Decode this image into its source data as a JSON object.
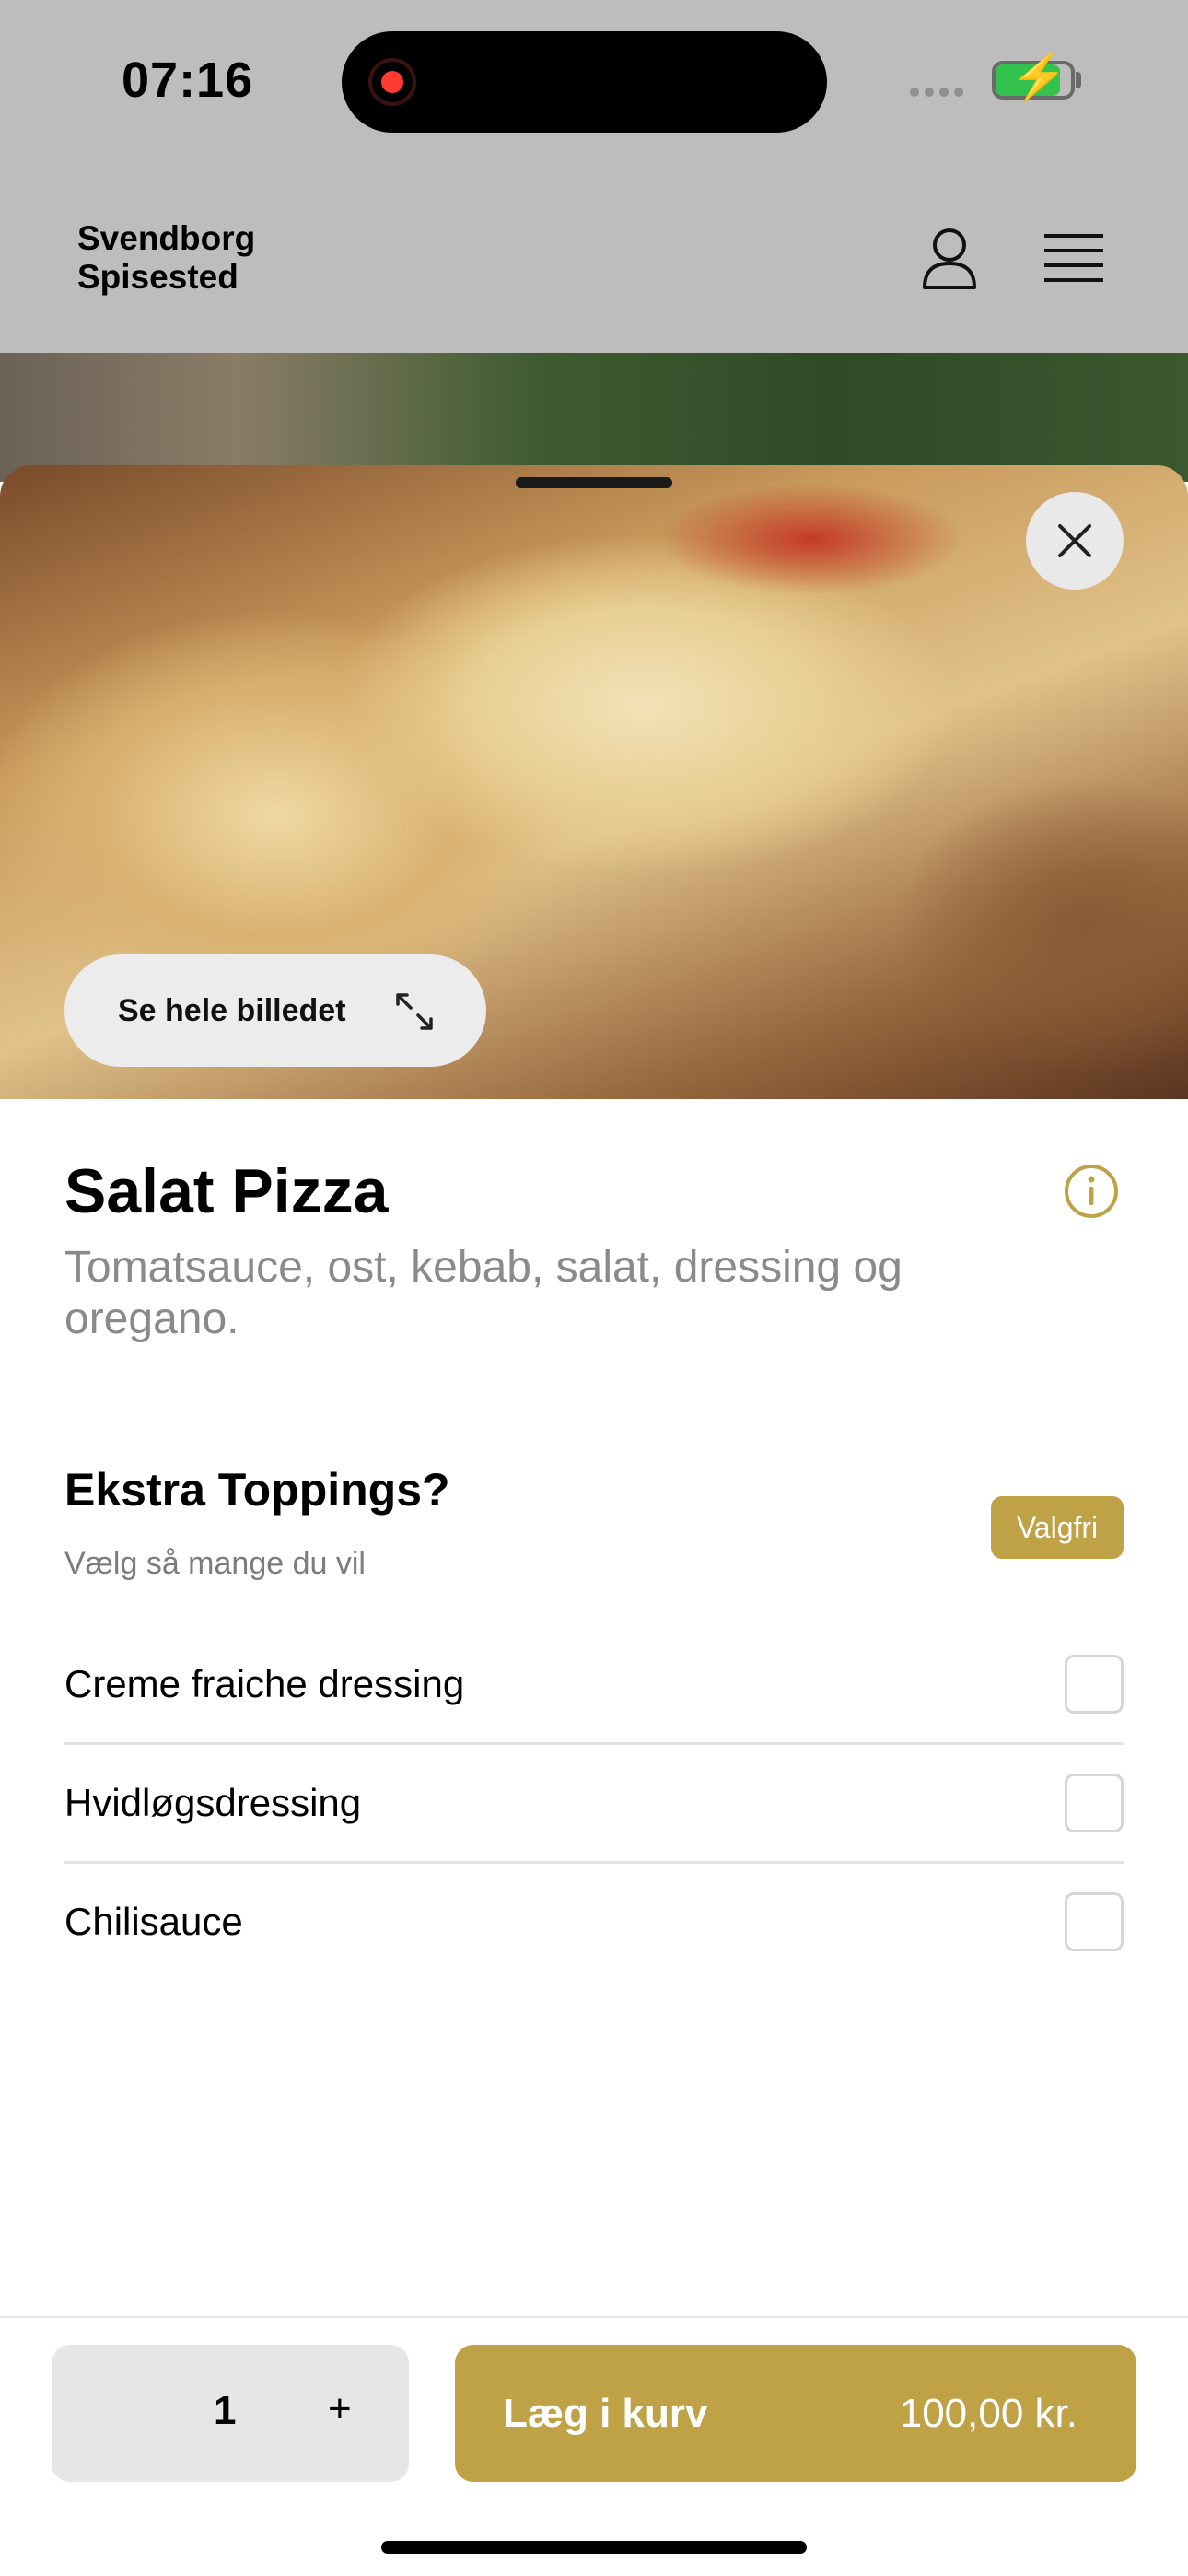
{
  "status_bar": {
    "time": "07:16"
  },
  "header": {
    "brand_line1": "Svendborg",
    "brand_line2": "Spisested"
  },
  "hero": {
    "see_full_image_label": "Se hele billedet"
  },
  "product": {
    "title": "Salat Pizza",
    "description": "Tomatsauce, ost, kebab, salat, dressing og oregano."
  },
  "options_group": {
    "title": "Ekstra Toppings?",
    "subtitle": "Vælg så mange du vil",
    "badge": "Valgfri",
    "items": [
      {
        "label": "Creme fraiche dressing",
        "checked": false
      },
      {
        "label": "Hvidløgsdressing",
        "checked": false
      },
      {
        "label": "Chilisauce",
        "checked": false
      }
    ]
  },
  "footer": {
    "quantity": "1",
    "plus_symbol": "+",
    "add_label": "Læg i kurv",
    "price": "100,00 kr."
  },
  "colors": {
    "accent": "#bfa146",
    "header_bg": "#bdbdbd"
  },
  "icons": [
    "user-icon",
    "menu-icon",
    "close-icon",
    "expand-icon",
    "info-icon"
  ]
}
